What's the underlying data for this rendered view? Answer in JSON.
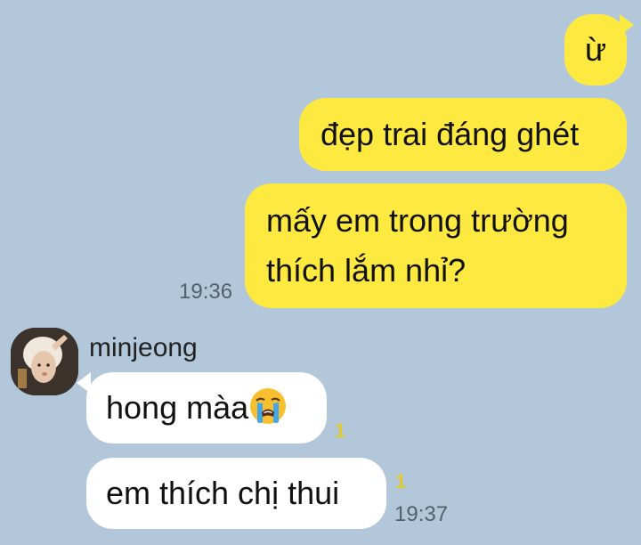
{
  "messages": {
    "m1": {
      "text": "ừ"
    },
    "m2": {
      "text": "đẹp trai đáng ghét"
    },
    "m3": {
      "line1": "mấy em trong trường",
      "line2": "thích lắm nhỉ?",
      "time": "19:36"
    },
    "sender": {
      "name": "minjeong"
    },
    "m4": {
      "text": "hong màa",
      "emoji": "loudly-crying-face-icon",
      "unread": "1"
    },
    "m5": {
      "text": "em thích chị thui",
      "unread": "1",
      "time": "19:37"
    }
  },
  "colors": {
    "background": "#b2c7da",
    "outgoing_bubble": "#fee941",
    "incoming_bubble": "#ffffff",
    "unread_count": "#e3c930"
  }
}
